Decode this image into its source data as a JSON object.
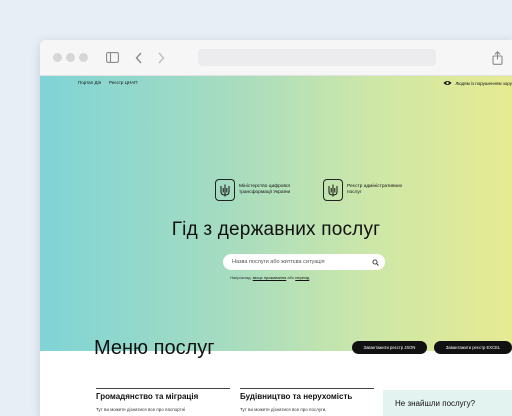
{
  "top_nav": {
    "items": [
      "Портал Дія",
      "Реєстр ЦНАП"
    ],
    "right_label": "Людям із порушенням зору"
  },
  "logos": [
    {
      "text": "Міністерство цифрової трансформації України"
    },
    {
      "text": "Реєстр адміністративних послуг"
    }
  ],
  "hero": {
    "title": "Гід з державних послуг",
    "search_placeholder": "Назва послуги або життєва ситуація",
    "hint_prefix": "Наприклад:",
    "hint_link1": "місце проживання",
    "hint_mid": "або",
    "hint_link2": "перехід"
  },
  "menu": {
    "title": "Меню послуг",
    "json_button": "Завантажити реєстр JSON",
    "excel_button": "Завантажити реєстр EXCEL"
  },
  "categories": [
    {
      "title": "Громадянство та міграція",
      "desc": "Тут ви можете дізнатися все про паспортні"
    },
    {
      "title": "Будівництво та нерухомість",
      "desc": "Тут ви можете дізнатися все про послуги,"
    }
  ],
  "not_found": "Не знайшли послугу?",
  "colors": {
    "gradient_start": "#7fd4d6",
    "gradient_end": "#e6eb92",
    "button_bg": "#111111",
    "not_found_bg": "#e3f3f0"
  }
}
